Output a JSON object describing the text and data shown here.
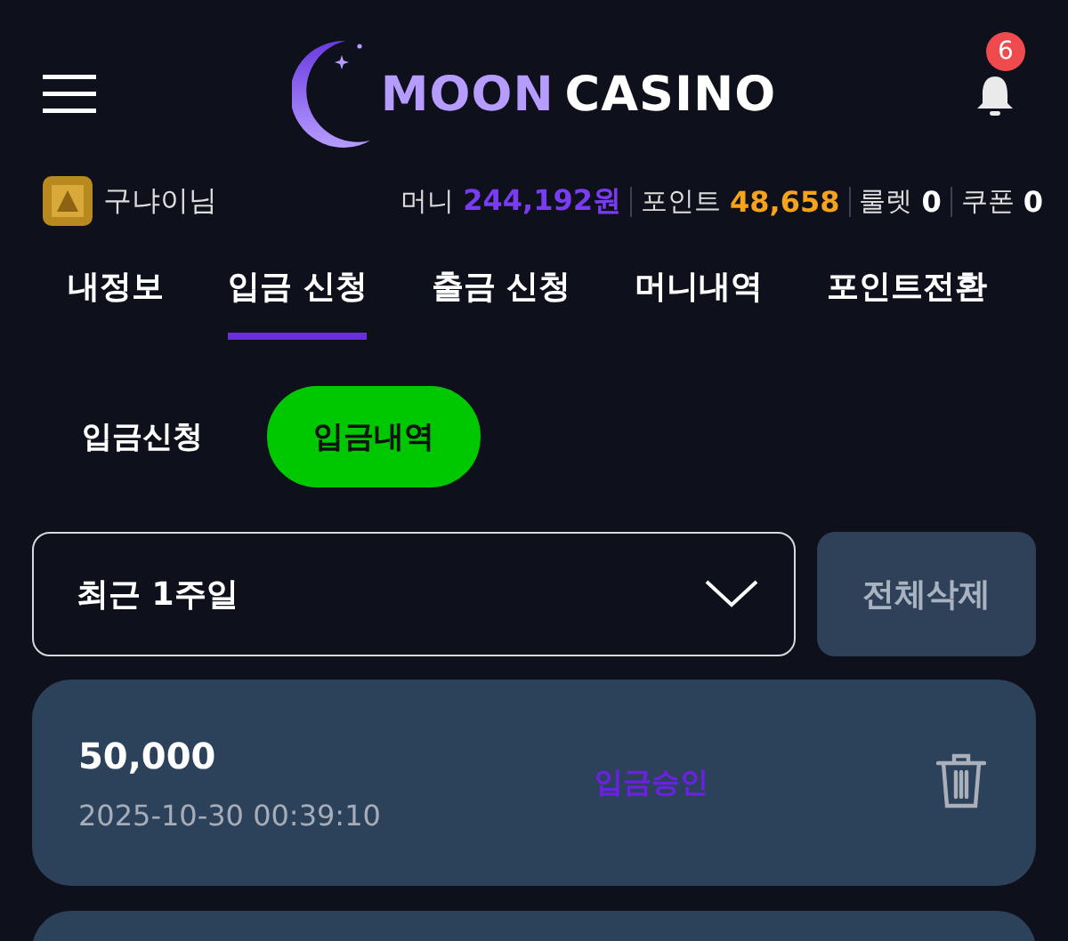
{
  "header": {
    "logo": {
      "first": "MOON",
      "second": "CASINO"
    },
    "notification_count": "6"
  },
  "user": {
    "name": "구냐이님",
    "stats": [
      {
        "label": "머니",
        "value": "244,192원",
        "kind": "money"
      },
      {
        "label": "포인트",
        "value": "48,658",
        "kind": "point"
      },
      {
        "label": "룰렛",
        "value": "0",
        "kind": "plain"
      },
      {
        "label": "쿠폰",
        "value": "0",
        "kind": "plain"
      }
    ]
  },
  "tabs": [
    {
      "label": "내정보",
      "selected": false
    },
    {
      "label": "입금 신청",
      "selected": true
    },
    {
      "label": "출금 신청",
      "selected": false
    },
    {
      "label": "머니내역",
      "selected": false
    },
    {
      "label": "포인트전환",
      "selected": false
    }
  ],
  "subtabs": [
    {
      "label": "입금신청",
      "selected": false
    },
    {
      "label": "입금내역",
      "selected": true
    }
  ],
  "filter": {
    "period": "최근 1주일",
    "delete_all": "전체삭제"
  },
  "records": [
    {
      "amount": "50,000",
      "datetime": "2025-10-30 00:39:10",
      "status": "입금승인"
    }
  ]
}
